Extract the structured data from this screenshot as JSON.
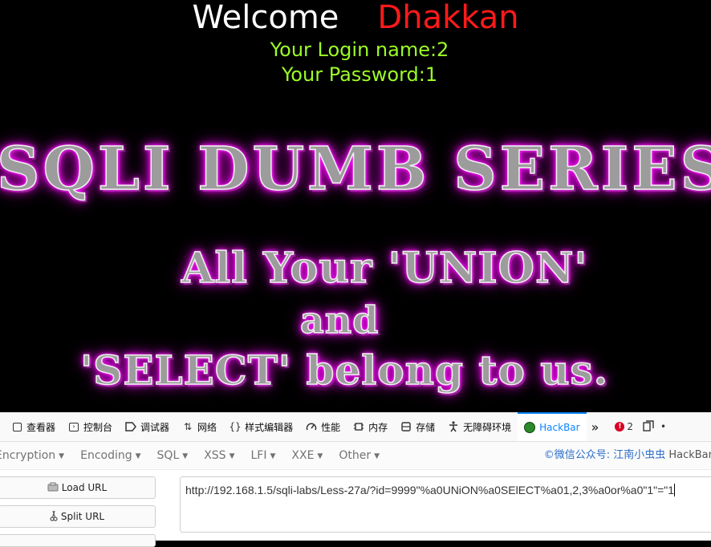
{
  "page": {
    "welcome": "Welcome",
    "username": "Dhakkan",
    "login_name": "Your Login name:2",
    "password": "Your Password:1",
    "banner": {
      "title": "SQLI DUMB SERIES",
      "line1": "All Your 'UNION'",
      "line2": "and",
      "line3": "'SELECT' belong to us."
    }
  },
  "devtools": {
    "tabs": [
      {
        "label": "查看器",
        "icon": "inspector-icon"
      },
      {
        "label": "控制台",
        "icon": "console-icon"
      },
      {
        "label": "调试器",
        "icon": "debugger-icon"
      },
      {
        "label": "网络",
        "icon": "network-icon"
      },
      {
        "label": "样式编辑器",
        "icon": "style-editor-icon"
      },
      {
        "label": "性能",
        "icon": "performance-icon"
      },
      {
        "label": "内存",
        "icon": "memory-icon"
      },
      {
        "label": "存储",
        "icon": "storage-icon"
      },
      {
        "label": "无障碍环境",
        "icon": "accessibility-icon"
      },
      {
        "label": "HackBar",
        "icon": "hackbar-icon",
        "active": true
      }
    ],
    "overflow": "»",
    "error_count": "2",
    "more": "•"
  },
  "hackbar": {
    "menu": [
      {
        "label": "Encryption"
      },
      {
        "label": "Encoding"
      },
      {
        "label": "SQL"
      },
      {
        "label": "XSS"
      },
      {
        "label": "LFI"
      },
      {
        "label": "XXE"
      },
      {
        "label": "Other"
      }
    ],
    "credit": "©微信公众号: 江南小虫虫",
    "credit_name": "HackBar",
    "load_url": "Load URL",
    "split_url": "Split URL",
    "url_value": "http://192.168.1.5/sqli-labs/Less-27a/?id=9999\"%a0UNiON%a0SElECT%a01,2,3%a0or%a0\"1\"=\"1"
  },
  "colors": {
    "welcome": "#ffffff",
    "username": "#ff1a1a",
    "login_text": "#9cfc26",
    "banner_glow": "#ff00ff",
    "active_tab": "#0a84ff"
  }
}
